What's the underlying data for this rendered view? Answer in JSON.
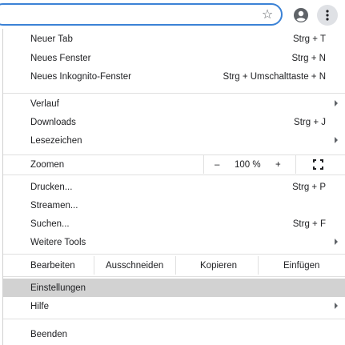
{
  "menu": {
    "new_tab": {
      "label": "Neuer Tab",
      "shortcut": "Strg + T"
    },
    "new_window": {
      "label": "Neues Fenster",
      "shortcut": "Strg + N"
    },
    "incognito": {
      "label": "Neues Inkognito-Fenster",
      "shortcut": "Strg + Umschalttaste + N"
    },
    "history": {
      "label": "Verlauf"
    },
    "downloads": {
      "label": "Downloads",
      "shortcut": "Strg + J"
    },
    "bookmarks": {
      "label": "Lesezeichen"
    },
    "zoom": {
      "label": "Zoomen",
      "minus": "–",
      "value": "100 %",
      "plus": "+"
    },
    "print": {
      "label": "Drucken...",
      "shortcut": "Strg + P"
    },
    "cast": {
      "label": "Streamen..."
    },
    "find": {
      "label": "Suchen...",
      "shortcut": "Strg + F"
    },
    "more_tools": {
      "label": "Weitere Tools"
    },
    "edit": {
      "label": "Bearbeiten",
      "cut": "Ausschneiden",
      "copy": "Kopieren",
      "paste": "Einfügen"
    },
    "settings": {
      "label": "Einstellungen"
    },
    "help": {
      "label": "Hilfe"
    },
    "exit": {
      "label": "Beenden"
    }
  },
  "toolbar": {
    "star_icon": "star-outline",
    "profile_icon": "account-circle",
    "menu_icon": "three-dot-vertical"
  },
  "colors": {
    "omnibox_focus": "#3b82d6",
    "highlight": "#d2d2d2",
    "kebab_bg": "#dfe1e5"
  }
}
